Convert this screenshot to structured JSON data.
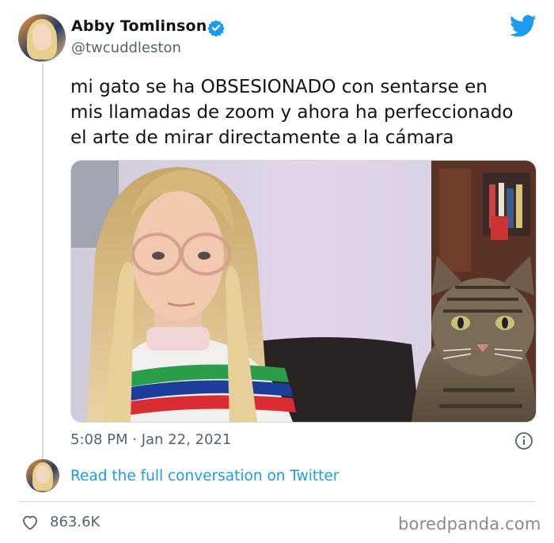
{
  "author": {
    "name": "Abby Tomlinson",
    "handle": "@twcuddleston",
    "verified": true
  },
  "tweet": {
    "text_lines": [
      "mi gato se ha OBSESIONADO con sentarse en",
      "mis llamadas de zoom y ahora ha perfeccionado",
      "el arte de mirar directamente a la cámara"
    ],
    "timestamp": "5:08 PM · Jan 22, 2021",
    "likes": "863.6K"
  },
  "footer": {
    "read_link": "Read the full conversation on Twitter"
  },
  "watermark": "boredpanda.com",
  "icons": {
    "brand": "twitter-bird-icon",
    "verified": "verified-badge-icon",
    "info": "info-icon",
    "like": "heart-icon"
  },
  "colors": {
    "accent": "#1d9bf0",
    "text": "#0f1419",
    "muted": "#536471",
    "border": "#cfd9de"
  }
}
